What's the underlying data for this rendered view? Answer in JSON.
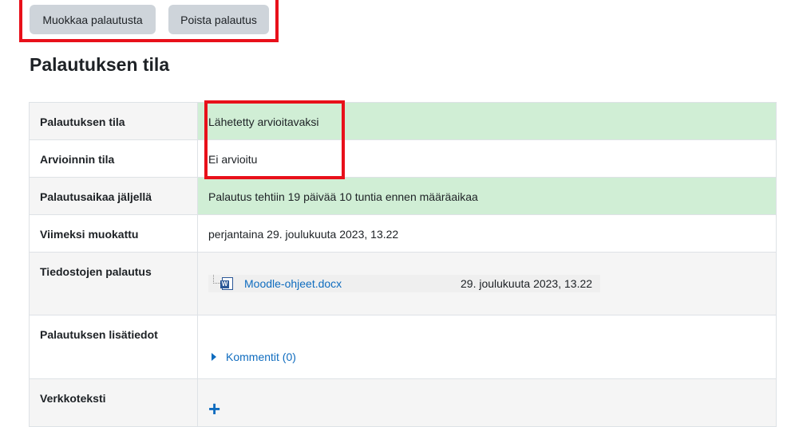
{
  "actions": {
    "edit_label": "Muokkaa palautusta",
    "remove_label": "Poista palautus"
  },
  "heading": "Palautuksen tila",
  "rows": [
    {
      "label": "Palautuksen tila",
      "value": "Lähetetty arvioitavaksi"
    },
    {
      "label": "Arvioinnin tila",
      "value": "Ei arvioitu"
    },
    {
      "label": "Palautusaikaa jäljellä",
      "value": "Palautus tehtiin 19 päivää 10 tuntia ennen määräaikaa"
    },
    {
      "label": "Viimeksi muokattu",
      "value": "perjantaina 29. joulukuuta 2023, 13.22"
    },
    {
      "label": "Tiedostojen palautus",
      "file": {
        "name": "Moodle-ohjeet.docx",
        "date": "29. joulukuuta 2023, 13.22",
        "icon": "word-doc-icon"
      }
    },
    {
      "label": "Palautuksen lisätiedot",
      "link": "Kommentit (0)"
    },
    {
      "label": "Verkkoteksti",
      "icon": "plus-icon"
    }
  ],
  "colors": {
    "highlight": "#e8101a",
    "success_bg": "#d0eed5",
    "link": "#0f6cbf"
  }
}
